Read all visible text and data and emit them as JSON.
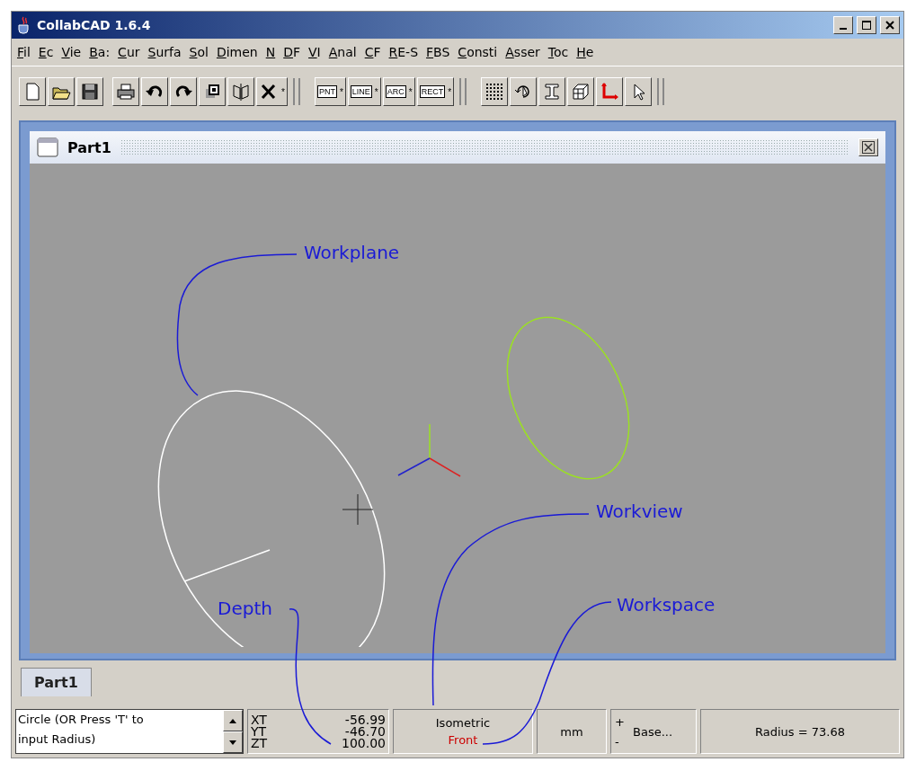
{
  "window": {
    "title": "CollabCAD 1.6.4"
  },
  "menu": [
    "Fil",
    "Ec",
    "Vie",
    "Ba:",
    "Cur",
    "Surfa",
    "Sol",
    "Dimen",
    "N",
    "DF",
    "VI",
    "Anal",
    "CF",
    "RE-S",
    "FBS",
    "Consti",
    "Asser",
    "Toc",
    "He"
  ],
  "toolbar": [
    {
      "kind": "new"
    },
    {
      "kind": "open"
    },
    {
      "kind": "save"
    },
    {
      "kind": "sep"
    },
    {
      "kind": "print"
    },
    {
      "kind": "undo"
    },
    {
      "kind": "redo"
    },
    {
      "kind": "copy"
    },
    {
      "kind": "mirror"
    },
    {
      "kind": "delete",
      "star": "*"
    },
    {
      "kind": "end"
    },
    {
      "kind": "text",
      "label": "PNT",
      "star": "*"
    },
    {
      "kind": "text",
      "label": "LINE",
      "star": "*"
    },
    {
      "kind": "text",
      "label": "ARC",
      "star": "*"
    },
    {
      "kind": "text",
      "label": "RECT",
      "star": "*"
    },
    {
      "kind": "end"
    },
    {
      "kind": "grid"
    },
    {
      "kind": "rotate"
    },
    {
      "kind": "ibeam"
    },
    {
      "kind": "box"
    },
    {
      "kind": "axes"
    },
    {
      "kind": "pointer"
    },
    {
      "kind": "end"
    }
  ],
  "document": {
    "title": "Part1",
    "annotations": [
      {
        "label": "Workplane"
      },
      {
        "label": "Workview"
      },
      {
        "label": "Workspace"
      },
      {
        "label": "Depth"
      }
    ]
  },
  "tabs": [
    {
      "label": "Part1",
      "selected": true
    }
  ],
  "status": {
    "prompt": [
      "Circle (OR Press 'T' to",
      "input Radius)"
    ],
    "coords": [
      {
        "axis": "XT",
        "value": "-56.99"
      },
      {
        "axis": "YT",
        "value": "-46.70"
      },
      {
        "axis": "ZT",
        "value": "100.00"
      }
    ],
    "view": {
      "projection": "Isometric",
      "orientation": "Front"
    },
    "units": "mm",
    "base": {
      "plus": "+",
      "minus": "-",
      "label": "Base..."
    },
    "radius": "Radius = 73.68"
  }
}
